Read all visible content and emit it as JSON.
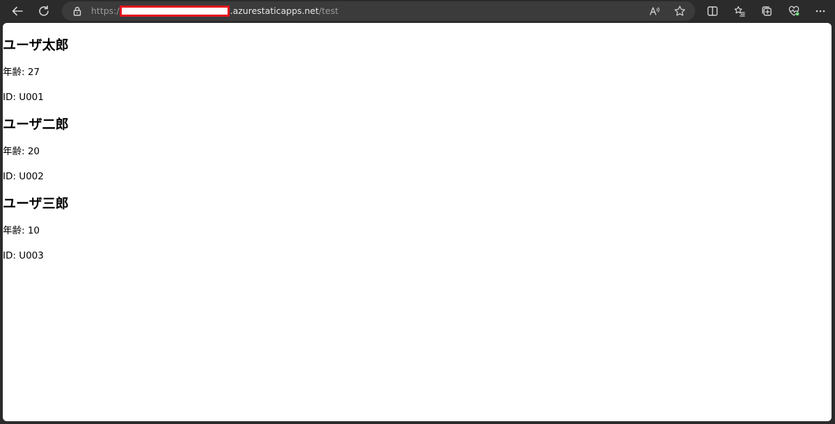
{
  "browser": {
    "url": {
      "scheme": "https:/",
      "domain": ".azurestaticapps.net",
      "path": "/test"
    }
  },
  "icons": {
    "back": "arrow-left-icon",
    "refresh": "refresh-icon",
    "lock": "lock-icon",
    "read_aloud": "read-aloud-icon",
    "favorite": "star-icon",
    "split_screen": "split-screen-icon",
    "favorites": "favorites-list-icon",
    "collections": "collections-icon",
    "health": "heart-pulse-icon",
    "more": "more-icon"
  },
  "colors": {
    "redaction_border": "#e3131b",
    "chrome_bg": "#2b2b2b",
    "address_bg": "#3b3b3b"
  },
  "page": {
    "users": [
      {
        "name": "ユーザ太郎",
        "age_text": "年齢: 27",
        "id_text": "ID: U001"
      },
      {
        "name": "ユーザ二郎",
        "age_text": "年齢: 20",
        "id_text": "ID: U002"
      },
      {
        "name": "ユーザ三郎",
        "age_text": "年齢: 10",
        "id_text": "ID: U003"
      }
    ]
  }
}
